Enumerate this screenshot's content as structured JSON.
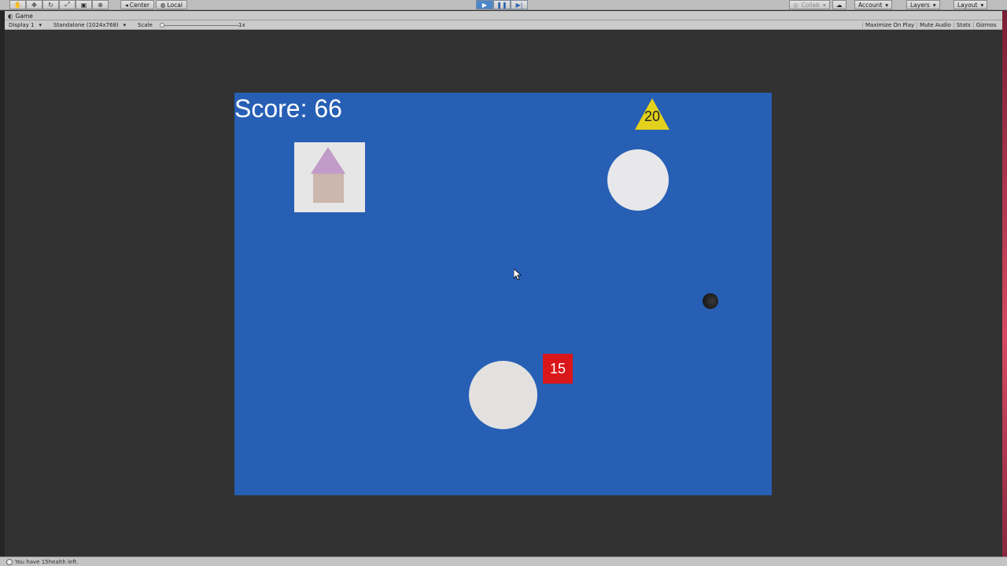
{
  "toolbar": {
    "pivot_label": "Center",
    "space_label": "Local",
    "collab_label": "Collab",
    "account_label": "Account",
    "layers_label": "Layers",
    "layout_label": "Layout"
  },
  "game_window": {
    "tab_title": "Game",
    "display": "Display 1",
    "resolution": "Standalone (1024x768)",
    "scale_label": "Scale",
    "scale_value": "1x",
    "maximize_on_play": "Maximize On Play",
    "mute_audio": "Mute Audio",
    "stats": "Stats",
    "gizmos": "Gizmos"
  },
  "game": {
    "score_text": "Score: 66",
    "triangle_value": "20",
    "red_square_value": "15"
  },
  "status": {
    "message": "You have 15health left."
  },
  "colors": {
    "game_background": "#275fb5",
    "editor_background": "#2f2f2f",
    "red_badge": "#d9171a",
    "triangle": "#e4d11b",
    "active_play": "#4a86c8"
  },
  "icons": {
    "hand": "hand-tool-icon",
    "move": "move-tool-icon",
    "rotate": "rotate-tool-icon",
    "scale": "scale-tool-icon",
    "rect": "rect-tool-icon",
    "transform": "transform-tool-icon",
    "play": "play-icon",
    "pause": "pause-icon",
    "step": "step-icon",
    "cloud": "cloud-icon"
  }
}
